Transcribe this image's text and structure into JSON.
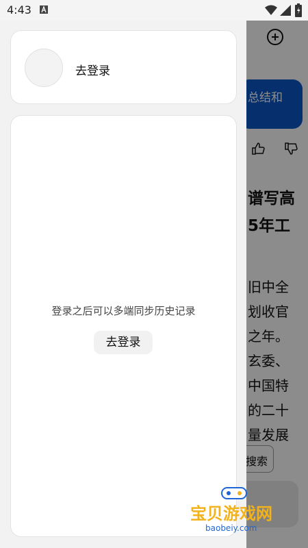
{
  "status_bar": {
    "time": "4:43"
  },
  "drawer": {
    "profile_card": {
      "login_label": "去登录"
    },
    "history_card": {
      "hint": "登录之后可以多端同步历史记录",
      "login_button_label": "去登录"
    }
  },
  "background_page": {
    "chip_text": "总结和",
    "headline_lines": [
      "谱写高",
      "5年工"
    ],
    "body_lines": [
      "旧中全",
      "划收官",
      "之年。",
      "玄委、",
      "中国特",
      "的二十",
      "量发展"
    ],
    "search_chip": "搜索"
  },
  "watermark": {
    "title": "宝贝游戏网",
    "url": "baobeiy.com"
  },
  "colors": {
    "primary_blue": "#0b56c8",
    "watermark_gold": "#f2b21b"
  }
}
